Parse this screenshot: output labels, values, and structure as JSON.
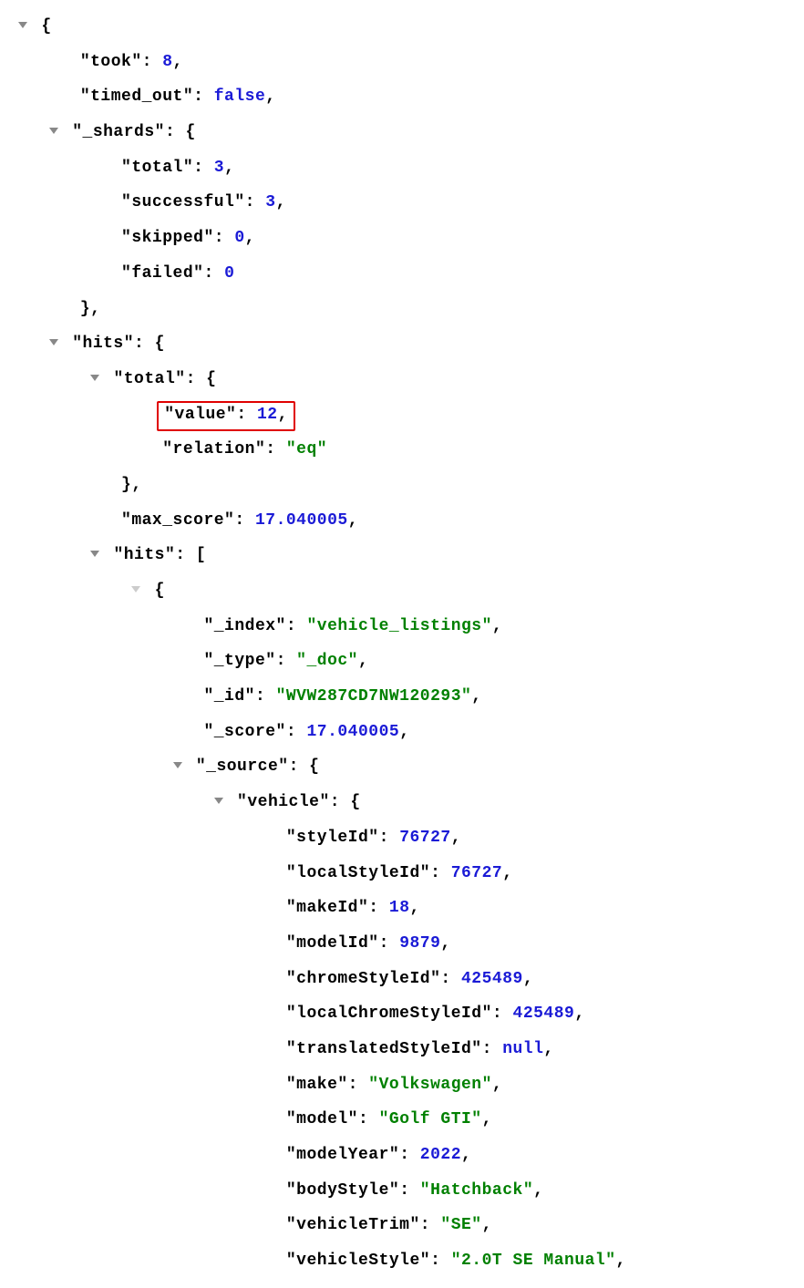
{
  "caret": "▼",
  "root_open": "{",
  "took_key": "\"took\"",
  "took_val": "8",
  "timed_out_key": "\"timed_out\"",
  "timed_out_val": "false",
  "shards_key": "\"_shards\"",
  "obj_open": "{",
  "shards_total_key": "\"total\"",
  "shards_total_val": "3",
  "shards_successful_key": "\"successful\"",
  "shards_successful_val": "3",
  "shards_skipped_key": "\"skipped\"",
  "shards_skipped_val": "0",
  "shards_failed_key": "\"failed\"",
  "shards_failed_val": "0",
  "obj_close_comma": "},",
  "hits_key": "\"hits\"",
  "hits_total_key": "\"total\"",
  "hits_total_value_key": "\"value\"",
  "hits_total_value_val": "12",
  "hits_total_relation_key": "\"relation\"",
  "hits_total_relation_val": "\"eq\"",
  "max_score_key": "\"max_score\"",
  "max_score_val": "17.040005",
  "hits_arr_key": "\"hits\"",
  "arr_open": "[",
  "index_key": "\"_index\"",
  "index_val": "\"vehicle_listings\"",
  "type_key": "\"_type\"",
  "type_val": "\"_doc\"",
  "id_key": "\"_id\"",
  "id_val": "\"WVW287CD7NW120293\"",
  "score_key": "\"_score\"",
  "score_val": "17.040005",
  "source_key": "\"_source\"",
  "vehicle_key": "\"vehicle\"",
  "styleId_key": "\"styleId\"",
  "styleId_val": "76727",
  "localStyleId_key": "\"localStyleId\"",
  "localStyleId_val": "76727",
  "makeId_key": "\"makeId\"",
  "makeId_val": "18",
  "modelId_key": "\"modelId\"",
  "modelId_val": "9879",
  "chromeStyleId_key": "\"chromeStyleId\"",
  "chromeStyleId_val": "425489",
  "localChromeStyleId_key": "\"localChromeStyleId\"",
  "localChromeStyleId_val": "425489",
  "translatedStyleId_key": "\"translatedStyleId\"",
  "translatedStyleId_val": "null",
  "make_key": "\"make\"",
  "make_val": "\"Volkswagen\"",
  "model_key": "\"model\"",
  "model_val": "\"Golf GTI\"",
  "modelYear_key": "\"modelYear\"",
  "modelYear_val": "2022",
  "bodyStyle_key": "\"bodyStyle\"",
  "bodyStyle_val": "\"Hatchback\"",
  "vehicleTrim_key": "\"vehicleTrim\"",
  "vehicleTrim_val": "\"SE\"",
  "vehicleStyle_key": "\"vehicleStyle\"",
  "vehicleStyle_val": "\"2.0T SE Manual\"",
  "colon": ": ",
  "comma": ","
}
